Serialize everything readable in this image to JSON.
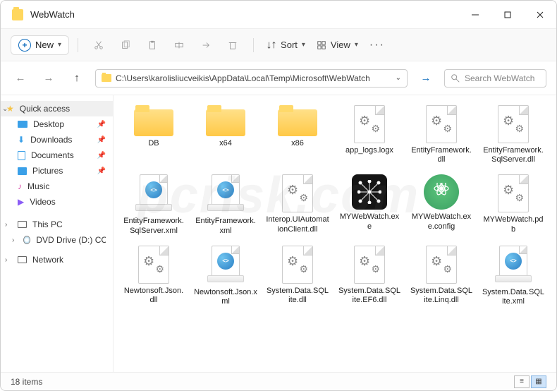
{
  "window": {
    "title": "WebWatch"
  },
  "toolbar": {
    "new_label": "New",
    "sort_label": "Sort",
    "view_label": "View"
  },
  "address": {
    "path": "C:\\Users\\karolisliucveikis\\AppData\\Local\\Temp\\Microsoft\\WebWatch"
  },
  "search": {
    "placeholder": "Search WebWatch"
  },
  "sidebar": {
    "quick_access": "Quick access",
    "items": [
      {
        "label": "Desktop"
      },
      {
        "label": "Downloads"
      },
      {
        "label": "Documents"
      },
      {
        "label": "Pictures"
      },
      {
        "label": "Music"
      },
      {
        "label": "Videos"
      }
    ],
    "this_pc": "This PC",
    "dvd": "DVD Drive (D:) CCCC",
    "network": "Network"
  },
  "files": [
    {
      "name": "DB",
      "type": "folder"
    },
    {
      "name": "x64",
      "type": "folder"
    },
    {
      "name": "x86",
      "type": "folder"
    },
    {
      "name": "app_logs.logx",
      "type": "file"
    },
    {
      "name": "EntityFramework.dll",
      "type": "dll"
    },
    {
      "name": "EntityFramework.SqlServer.dll",
      "type": "dll"
    },
    {
      "name": "EntityFramework.SqlServer.xml",
      "type": "xml"
    },
    {
      "name": "EntityFramework.xml",
      "type": "xml"
    },
    {
      "name": "Interop.UIAutomationClient.dll",
      "type": "dll"
    },
    {
      "name": "MYWebWatch.exe",
      "type": "exe_dark"
    },
    {
      "name": "MYWebWatch.exe.config",
      "type": "exe_green"
    },
    {
      "name": "MYWebWatch.pdb",
      "type": "file"
    },
    {
      "name": "Newtonsoft.Json.dll",
      "type": "dll"
    },
    {
      "name": "Newtonsoft.Json.xml",
      "type": "xml"
    },
    {
      "name": "System.Data.SQLite.dll",
      "type": "dll"
    },
    {
      "name": "System.Data.SQLite.EF6.dll",
      "type": "dll"
    },
    {
      "name": "System.Data.SQLite.Linq.dll",
      "type": "dll"
    },
    {
      "name": "System.Data.SQLite.xml",
      "type": "xml"
    }
  ],
  "status": {
    "item_count": "18 items"
  },
  "watermark": "pcrisk.com"
}
